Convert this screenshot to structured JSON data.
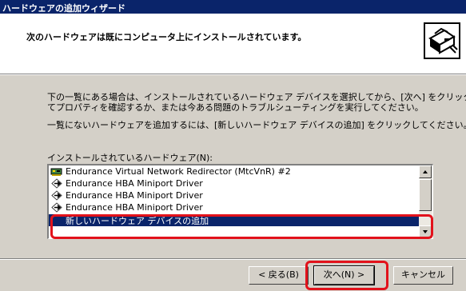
{
  "window": {
    "title": "ハードウェアの追加ウィザード"
  },
  "header": {
    "heading": "次のハードウェアは既にコンピュータ上にインストールされています。",
    "icon": "wizard-hardware-icon"
  },
  "body": {
    "paragraph1_line1": "下の一覧にある場合は、インストールされているハードウェア デバイスを選択してから、[次へ] をクリックし",
    "paragraph1_line2": "てプロパティを確認するか、または今ある問題のトラブルシューティングを実行してください。",
    "paragraph2": "一覧にないハードウェアを追加するには、[新しいハードウェア デバイスの追加] をクリックしてください。"
  },
  "list": {
    "label": "インストールされているハードウェア(N):",
    "items": [
      {
        "label": "Endurance Virtual Network Redirector (MtcVnR) #2",
        "icon": "network-card-icon"
      },
      {
        "label": "Endurance HBA Miniport Driver",
        "icon": "scsi-adapter-icon"
      },
      {
        "label": "Endurance HBA Miniport Driver",
        "icon": "scsi-adapter-icon"
      },
      {
        "label": "Endurance HBA Miniport Driver",
        "icon": "scsi-adapter-icon"
      },
      {
        "label": "新しいハードウェア デバイスの追加",
        "selected": true
      }
    ]
  },
  "buttons": {
    "back": "< 戻る(B)",
    "next": "次へ(N) >",
    "cancel": "キャンセル"
  },
  "colors": {
    "title_bar": "#0a246a",
    "selection": "#0a246a",
    "highlight_ring": "#e2121b",
    "dialog_face": "#d4d0c8"
  }
}
